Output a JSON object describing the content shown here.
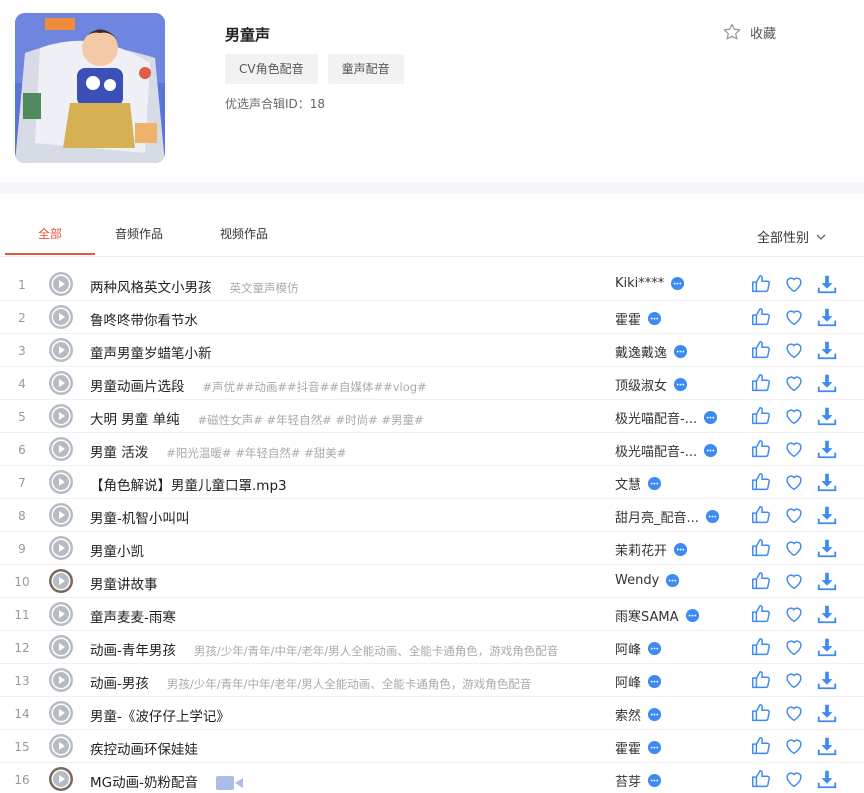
{
  "album": {
    "title": "男童声",
    "tags": [
      "CV角色配音",
      "童声配音"
    ],
    "id_text": "优选声合辑ID：18",
    "favorite_label": "收藏"
  },
  "tabs": [
    {
      "label": "全部",
      "active": true
    },
    {
      "label": "音频作品",
      "active": false
    },
    {
      "label": "视频作品",
      "active": false
    }
  ],
  "gender_filter": "全部性别",
  "colors": {
    "accent": "#e8543e",
    "icon_blue": "#3d8bf2"
  },
  "tracks": [
    {
      "index": "1",
      "title": "两种风格英文小男孩",
      "desc": "英文童声模仿",
      "author": "Kiki****"
    },
    {
      "index": "2",
      "title": "鲁咚咚带你看节水",
      "desc": "",
      "author": "霍霍"
    },
    {
      "index": "3",
      "title": "童声男童岁蜡笔小新",
      "desc": "",
      "author": "戴逸戴逸"
    },
    {
      "index": "4",
      "title": "男童动画片选段",
      "desc": "#声优##动画##抖音##自媒体##vlog#",
      "author": "顶级淑女"
    },
    {
      "index": "5",
      "title": "大明 男童 单纯",
      "desc": "#磁性女声# #年轻自然# #时尚# #男童#",
      "author": "极光喵配音-..."
    },
    {
      "index": "6",
      "title": "男童 活泼",
      "desc": "#阳光温暖# #年轻自然# #甜美#",
      "author": "极光喵配音-..."
    },
    {
      "index": "7",
      "title": "【角色解说】男童儿童口罩.mp3",
      "desc": "",
      "author": "文慧"
    },
    {
      "index": "8",
      "title": "男童-机智小叫叫",
      "desc": "",
      "author": "甜月亮_配音..."
    },
    {
      "index": "9",
      "title": "男童小凯",
      "desc": "",
      "author": "茉莉花开"
    },
    {
      "index": "10",
      "title": "男童讲故事",
      "desc": "",
      "author": "Wendy"
    },
    {
      "index": "11",
      "title": "童声麦麦-雨寒",
      "desc": "",
      "author": "雨寒SAMA"
    },
    {
      "index": "12",
      "title": "动画-青年男孩",
      "desc": "男孩/少年/青年/中年/老年/男人全能动画、全能卡通角色，游戏角色配音",
      "author": "阿峰"
    },
    {
      "index": "13",
      "title": "动画-男孩",
      "desc": "男孩/少年/青年/中年/老年/男人全能动画、全能卡通角色，游戏角色配音",
      "author": "阿峰"
    },
    {
      "index": "14",
      "title": "男童-《波仔仔上学记》",
      "desc": "",
      "author": "索然"
    },
    {
      "index": "15",
      "title": "疾控动画环保娃娃",
      "desc": "",
      "author": "霍霍"
    },
    {
      "index": "16",
      "title": "MG动画-奶粉配音",
      "desc": "",
      "author": "苔芽",
      "video": true
    }
  ]
}
